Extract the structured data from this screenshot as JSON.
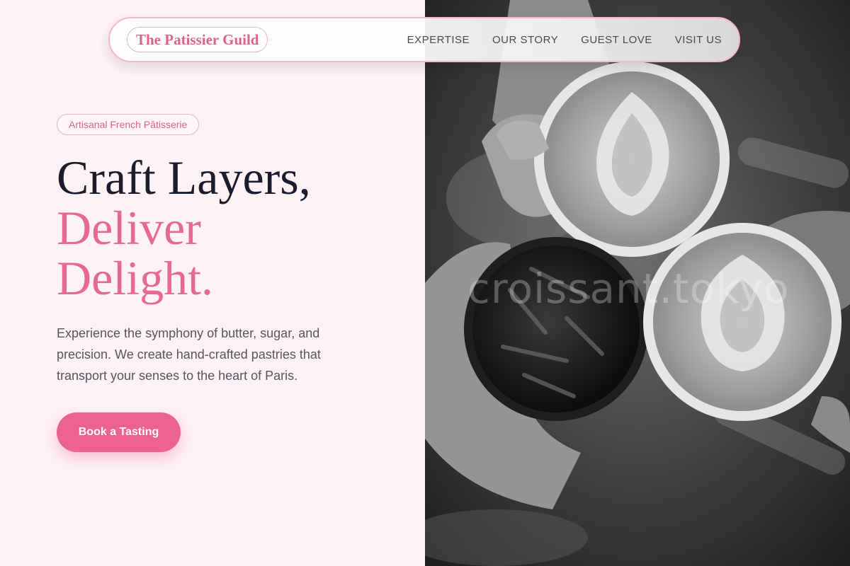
{
  "nav": {
    "brand": "The Patissier Guild",
    "links": [
      "EXPERTISE",
      "OUR STORY",
      "GUEST LOVE",
      "VISIT US"
    ]
  },
  "hero": {
    "badge": "Artisanal French Pâtisserie",
    "headline_line1": "Craft Layers,",
    "headline_line2": "Deliver",
    "headline_line3": "Delight.",
    "description": "Experience the symphony of butter, sugar, and precision. We create hand-crafted pastries that transport your senses to the heart of Paris.",
    "cta_label": "Book a Tasting"
  },
  "image": {
    "subject": "hands-toasting-coffee-cups-photo",
    "watermark": "croissant.tokyo"
  },
  "colors": {
    "accent": "#ec6393",
    "headline": "#1a1d2e",
    "background": "#fff2f4"
  }
}
